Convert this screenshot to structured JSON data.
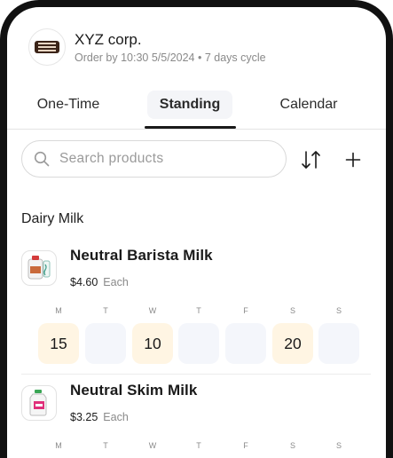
{
  "header": {
    "company_name": "XYZ corp.",
    "order_info": "Order by 10:30 5/5/2024 • 7 days cycle"
  },
  "tabs": [
    {
      "label": "One-Time",
      "active": false
    },
    {
      "label": "Standing",
      "active": true
    },
    {
      "label": "Calendar",
      "active": false
    }
  ],
  "search": {
    "placeholder": "Search products",
    "value": ""
  },
  "icons": {
    "search": "search-icon",
    "sort": "sort-icon",
    "add": "plus-icon"
  },
  "section": {
    "title": "Dairy Milk"
  },
  "colors": {
    "filled_day": "#fff5e3",
    "empty_day": "#f4f6fb",
    "active_tab_bg": "#f4f5f8"
  },
  "products": [
    {
      "name": "Neutral Barista Milk",
      "price": "$4.60",
      "unit": "Each",
      "days": [
        {
          "label": "M",
          "qty": "15"
        },
        {
          "label": "T",
          "qty": ""
        },
        {
          "label": "W",
          "qty": "10"
        },
        {
          "label": "T",
          "qty": ""
        },
        {
          "label": "F",
          "qty": ""
        },
        {
          "label": "S",
          "qty": "20"
        },
        {
          "label": "S",
          "qty": ""
        }
      ]
    },
    {
      "name": "Neutral Skim Milk",
      "price": "$3.25",
      "unit": "Each",
      "days": [
        {
          "label": "M",
          "qty": ""
        },
        {
          "label": "T",
          "qty": ""
        },
        {
          "label": "W",
          "qty": ""
        },
        {
          "label": "T",
          "qty": ""
        },
        {
          "label": "F",
          "qty": ""
        },
        {
          "label": "S",
          "qty": ""
        },
        {
          "label": "S",
          "qty": ""
        }
      ]
    }
  ]
}
